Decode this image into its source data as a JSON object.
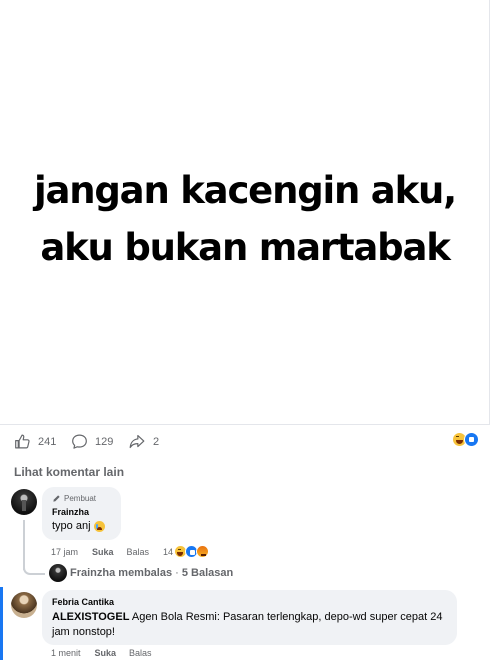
{
  "post": {
    "meme_line_1": "jangan kacengin aku,",
    "meme_line_2": "aku bukan martabak"
  },
  "stats": {
    "likes": "241",
    "comments": "129",
    "shares": "2",
    "reactions": [
      "haha-icon",
      "like-icon"
    ]
  },
  "more_comments_label": "Lihat komentar lain",
  "comment_1": {
    "badge": "Pembuat",
    "author": "Frainzha",
    "text": "typo anj",
    "emoji": "crying-emoji",
    "time": "17 jam",
    "like_label": "Suka",
    "reply_label": "Balas",
    "reaction_count": "14",
    "reactions": [
      "haha-icon",
      "like-icon",
      "angry-icon"
    ]
  },
  "replies": {
    "author": "Frainzha membalas",
    "separator": " · ",
    "count": "5 Balasan"
  },
  "comment_2": {
    "author": "Febria Cantika",
    "bold_text": "ALEXISTOGEL",
    "text": " Agen Bola Resmi: Pasaran terlengkap, depo-wd super cepat 24 jam nonstop!",
    "time": "1 menit",
    "like_label": "Suka",
    "reply_label": "Balas"
  },
  "colors": {
    "accent": "#1877f2",
    "secondary_text": "#65676b",
    "bubble": "#f0f2f5"
  }
}
